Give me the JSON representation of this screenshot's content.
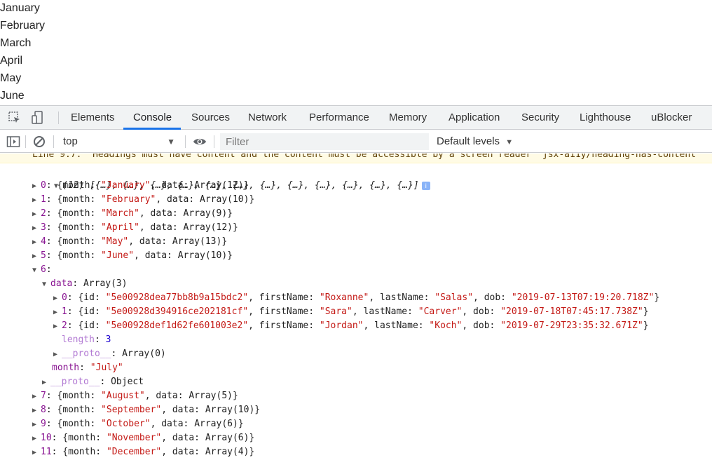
{
  "page": {
    "months": [
      "January",
      "February",
      "March",
      "April",
      "May",
      "June"
    ]
  },
  "devtools": {
    "tabs": [
      "Elements",
      "Console",
      "Sources",
      "Network",
      "Performance",
      "Memory",
      "Application",
      "Security",
      "Lighthouse",
      "uBlocker"
    ],
    "active_tab": "Console",
    "context": "top",
    "filter_placeholder": "Filter",
    "levels_label": "Default levels",
    "icons": [
      "inspect-element-icon",
      "device-toolbar-icon",
      "sidebar-toggle-icon",
      "clear-console-icon",
      "eye-icon",
      "dropdown-arrow-icon"
    ],
    "accent_color": "#1a73e8"
  },
  "console": {
    "warning": "Line 9:7:  Headings must have content and the content must be accessible by a screen reader  jsx-a11y/heading-has-content",
    "array_summary": "(12) [{…}, {…}, {…}, {…}, {…}, {…}, {…}, {…}, {…}, {…}, {…}, {…}]",
    "items": [
      {
        "index": "0",
        "month": "\"January\"",
        "data": "Array(12)"
      },
      {
        "index": "1",
        "month": "\"February\"",
        "data": "Array(10)"
      },
      {
        "index": "2",
        "month": "\"March\"",
        "data": "Array(9)"
      },
      {
        "index": "3",
        "month": "\"April\"",
        "data": "Array(12)"
      },
      {
        "index": "4",
        "month": "\"May\"",
        "data": "Array(13)"
      },
      {
        "index": "5",
        "month": "\"June\"",
        "data": "Array(10)"
      },
      {
        "index": "7",
        "month": "\"August\"",
        "data": "Array(5)"
      },
      {
        "index": "8",
        "month": "\"September\"",
        "data": "Array(10)"
      },
      {
        "index": "9",
        "month": "\"October\"",
        "data": "Array(6)"
      },
      {
        "index": "10",
        "month": "\"November\"",
        "data": "Array(6)"
      },
      {
        "index": "11",
        "month": "\"December\"",
        "data": "Array(4)"
      }
    ],
    "expanded": {
      "index": "6",
      "data_label": "Array(3)",
      "entries": [
        {
          "index": "0",
          "id": "\"5e00928dea77bb8b9a15bdc2\"",
          "firstName": "\"Roxanne\"",
          "lastName": "\"Salas\"",
          "dob": "\"2019-07-13T07:19:20.718Z\""
        },
        {
          "index": "1",
          "id": "\"5e00928d394916ce202181cf\"",
          "firstName": "\"Sara\"",
          "lastName": "\"Carver\"",
          "dob": "\"2019-07-18T07:45:17.738Z\""
        },
        {
          "index": "2",
          "id": "\"5e00928def1d62fe601003e2\"",
          "firstName": "\"Jordan\"",
          "lastName": "\"Koch\"",
          "dob": "\"2019-07-29T23:35:32.671Z\""
        }
      ],
      "length": "3",
      "proto_array": "Array(0)",
      "month": "\"July\"",
      "proto_object": "Object"
    }
  }
}
